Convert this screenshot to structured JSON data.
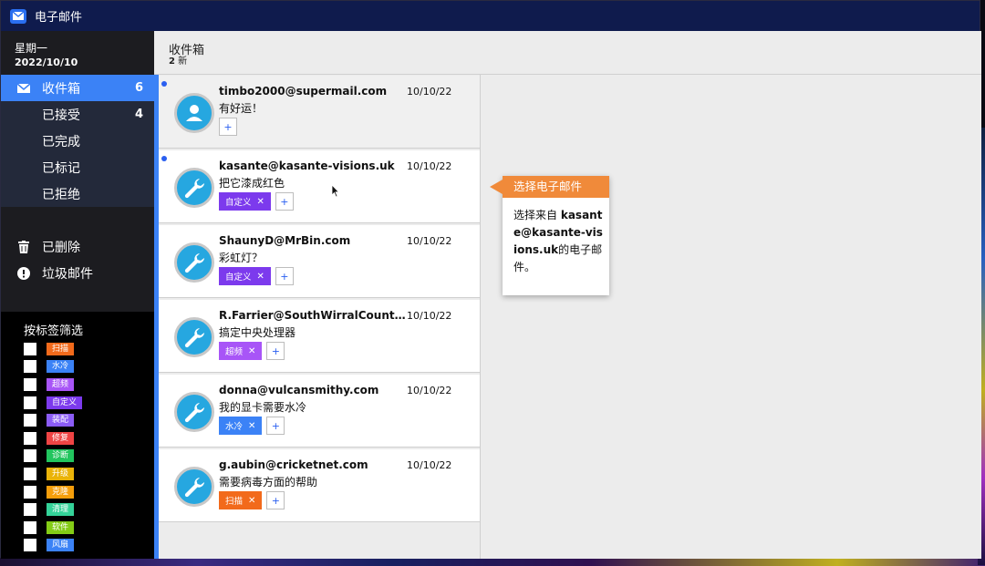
{
  "window": {
    "title": "电子邮件",
    "app_icon": "mail-icon"
  },
  "sidebar": {
    "weekday": "星期一",
    "date": "2022/10/10",
    "items": [
      {
        "label": "收件箱",
        "count": "6",
        "icon": "inbox-icon",
        "active": true
      },
      {
        "label": "已接受",
        "count": "4"
      },
      {
        "label": "已完成",
        "count": ""
      },
      {
        "label": "已标记",
        "count": ""
      },
      {
        "label": "已拒绝",
        "count": ""
      }
    ],
    "items2": [
      {
        "label": "已删除",
        "icon": "trash-icon"
      },
      {
        "label": "垃圾邮件",
        "icon": "alert-icon"
      }
    ],
    "filter_title": "按标签筛选",
    "filter_tags": [
      {
        "label": "扫描",
        "color": "#f26a1b"
      },
      {
        "label": "水冷",
        "color": "#3b82f6"
      },
      {
        "label": "超频",
        "color": "#a855f7"
      },
      {
        "label": "自定义",
        "color": "#7c3aed"
      },
      {
        "label": "装配",
        "color": "#8b5cf6"
      },
      {
        "label": "修复",
        "color": "#ef4444"
      },
      {
        "label": "诊断",
        "color": "#22c55e"
      },
      {
        "label": "升级",
        "color": "#eab308"
      },
      {
        "label": "克隆",
        "color": "#f59e0b"
      },
      {
        "label": "清理",
        "color": "#34d399"
      },
      {
        "label": "软件",
        "color": "#84cc16"
      },
      {
        "label": "风扇",
        "color": "#3b82f6"
      }
    ]
  },
  "list": {
    "title": "收件箱",
    "new_count": "2",
    "new_label": "新",
    "mails": [
      {
        "sender": "timbo2000@supermail.com",
        "date": "10/10/22",
        "subject": "有好运！",
        "unread": true,
        "avatar": "user-icon",
        "tags": []
      },
      {
        "sender": "kasante@kasante-visions.uk",
        "date": "10/10/22",
        "subject": "把它漆成红色",
        "unread": true,
        "avatar": "wrench-icon",
        "tags": [
          {
            "label": "自定义",
            "color": "#7c3aed"
          }
        ]
      },
      {
        "sender": "ShaunyD@MrBin.com",
        "date": "10/10/22",
        "subject": "彩虹灯？",
        "unread": false,
        "avatar": "wrench-icon",
        "tags": [
          {
            "label": "自定义",
            "color": "#7c3aed"
          }
        ]
      },
      {
        "sender": "R.Farrier@SouthWirralCountr…",
        "date": "10/10/22",
        "subject": "搞定中央处理器",
        "unread": false,
        "avatar": "wrench-icon",
        "tags": [
          {
            "label": "超频",
            "color": "#a855f7"
          }
        ]
      },
      {
        "sender": "donna@vulcansmithy.com",
        "date": "10/10/22",
        "subject": "我的显卡需要水冷",
        "unread": false,
        "avatar": "wrench-icon",
        "tags": [
          {
            "label": "水冷",
            "color": "#3b82f6"
          }
        ]
      },
      {
        "sender": "g.aubin@cricketnet.com",
        "date": "10/10/22",
        "subject": "需要病毒方面的帮助",
        "unread": false,
        "avatar": "wrench-icon",
        "tags": [
          {
            "label": "扫描",
            "color": "#f26a1b"
          }
        ]
      }
    ]
  },
  "tooltip": {
    "title": "选择电子邮件",
    "body_prefix": "选择来自",
    "body_email": "kasante@kasante-visions.uk",
    "body_suffix": "的电子邮件。"
  },
  "colors": {
    "accent": "#3b82f6",
    "titlebar": "#0f1b4d",
    "tooltip": "#f08a3a"
  }
}
